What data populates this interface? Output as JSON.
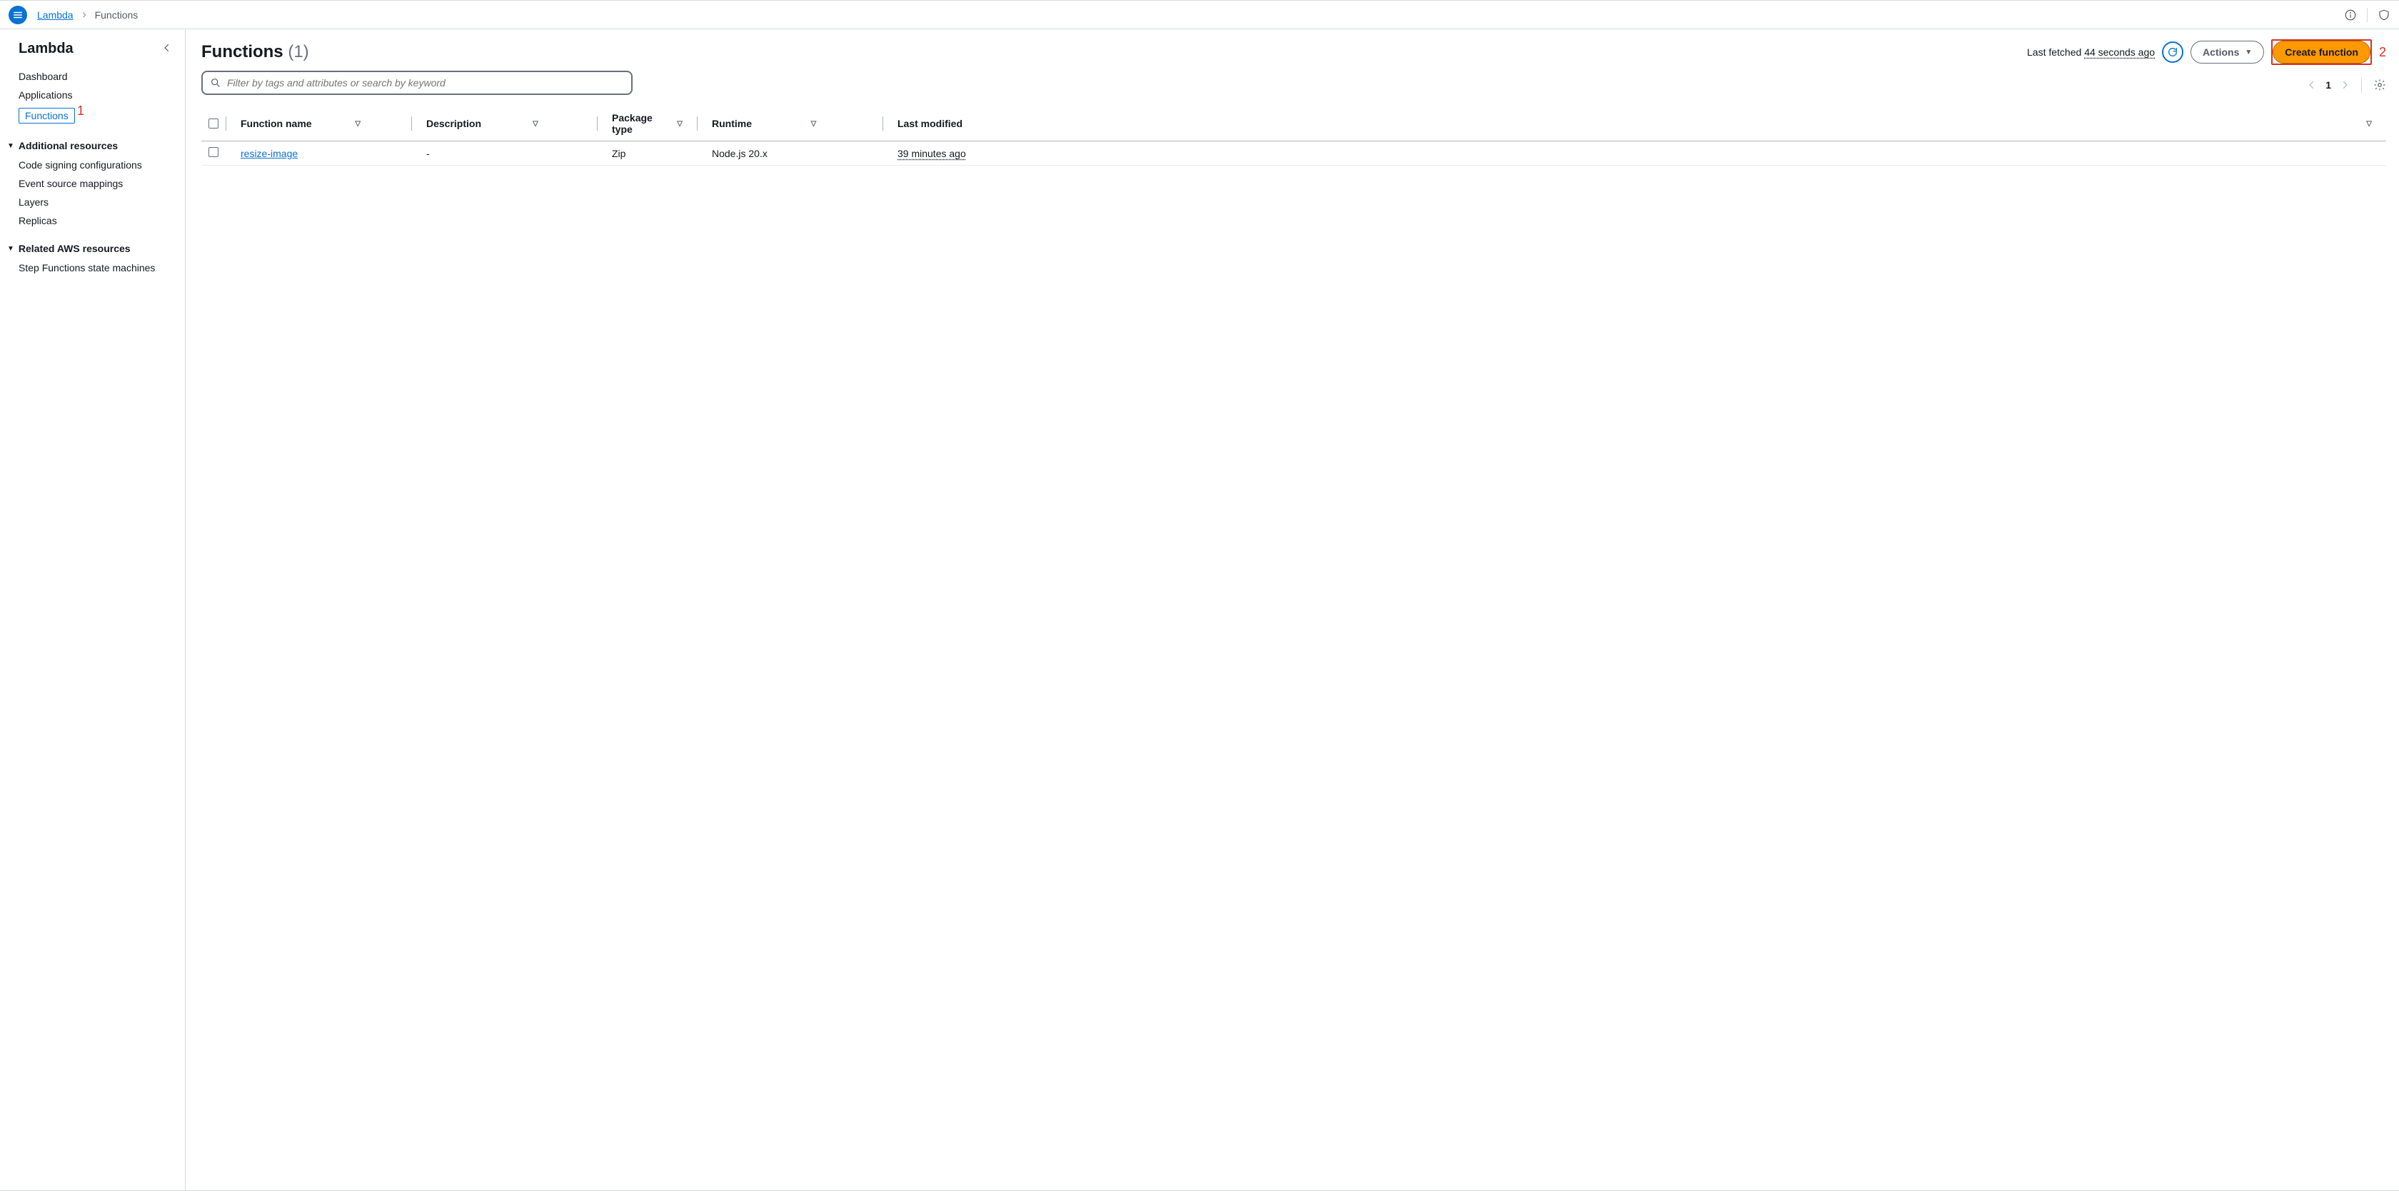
{
  "breadcrumb": {
    "root": "Lambda",
    "current": "Functions"
  },
  "sidebar": {
    "title": "Lambda",
    "items": [
      {
        "label": "Dashboard"
      },
      {
        "label": "Applications"
      },
      {
        "label": "Functions",
        "active": true,
        "callout": "1"
      }
    ],
    "group1": {
      "label": "Additional resources",
      "items": [
        {
          "label": "Code signing configurations"
        },
        {
          "label": "Event source mappings"
        },
        {
          "label": "Layers"
        },
        {
          "label": "Replicas"
        }
      ]
    },
    "group2": {
      "label": "Related AWS resources",
      "items": [
        {
          "label": "Step Functions state machines"
        }
      ]
    }
  },
  "header": {
    "title": "Functions",
    "count": "(1)",
    "last_fetched_prefix": "Last fetched ",
    "last_fetched_value": "44 seconds ago",
    "actions_label": "Actions",
    "create_label": "Create function",
    "create_callout": "2"
  },
  "search": {
    "placeholder": "Filter by tags and attributes or search by keyword"
  },
  "pager": {
    "page": "1"
  },
  "table": {
    "columns": [
      "Function name",
      "Description",
      "Package type",
      "Runtime",
      "Last modified"
    ],
    "rows": [
      {
        "name": "resize-image",
        "description": "-",
        "package_type": "Zip",
        "runtime": "Node.js 20.x",
        "last_modified": "39 minutes ago"
      }
    ]
  }
}
